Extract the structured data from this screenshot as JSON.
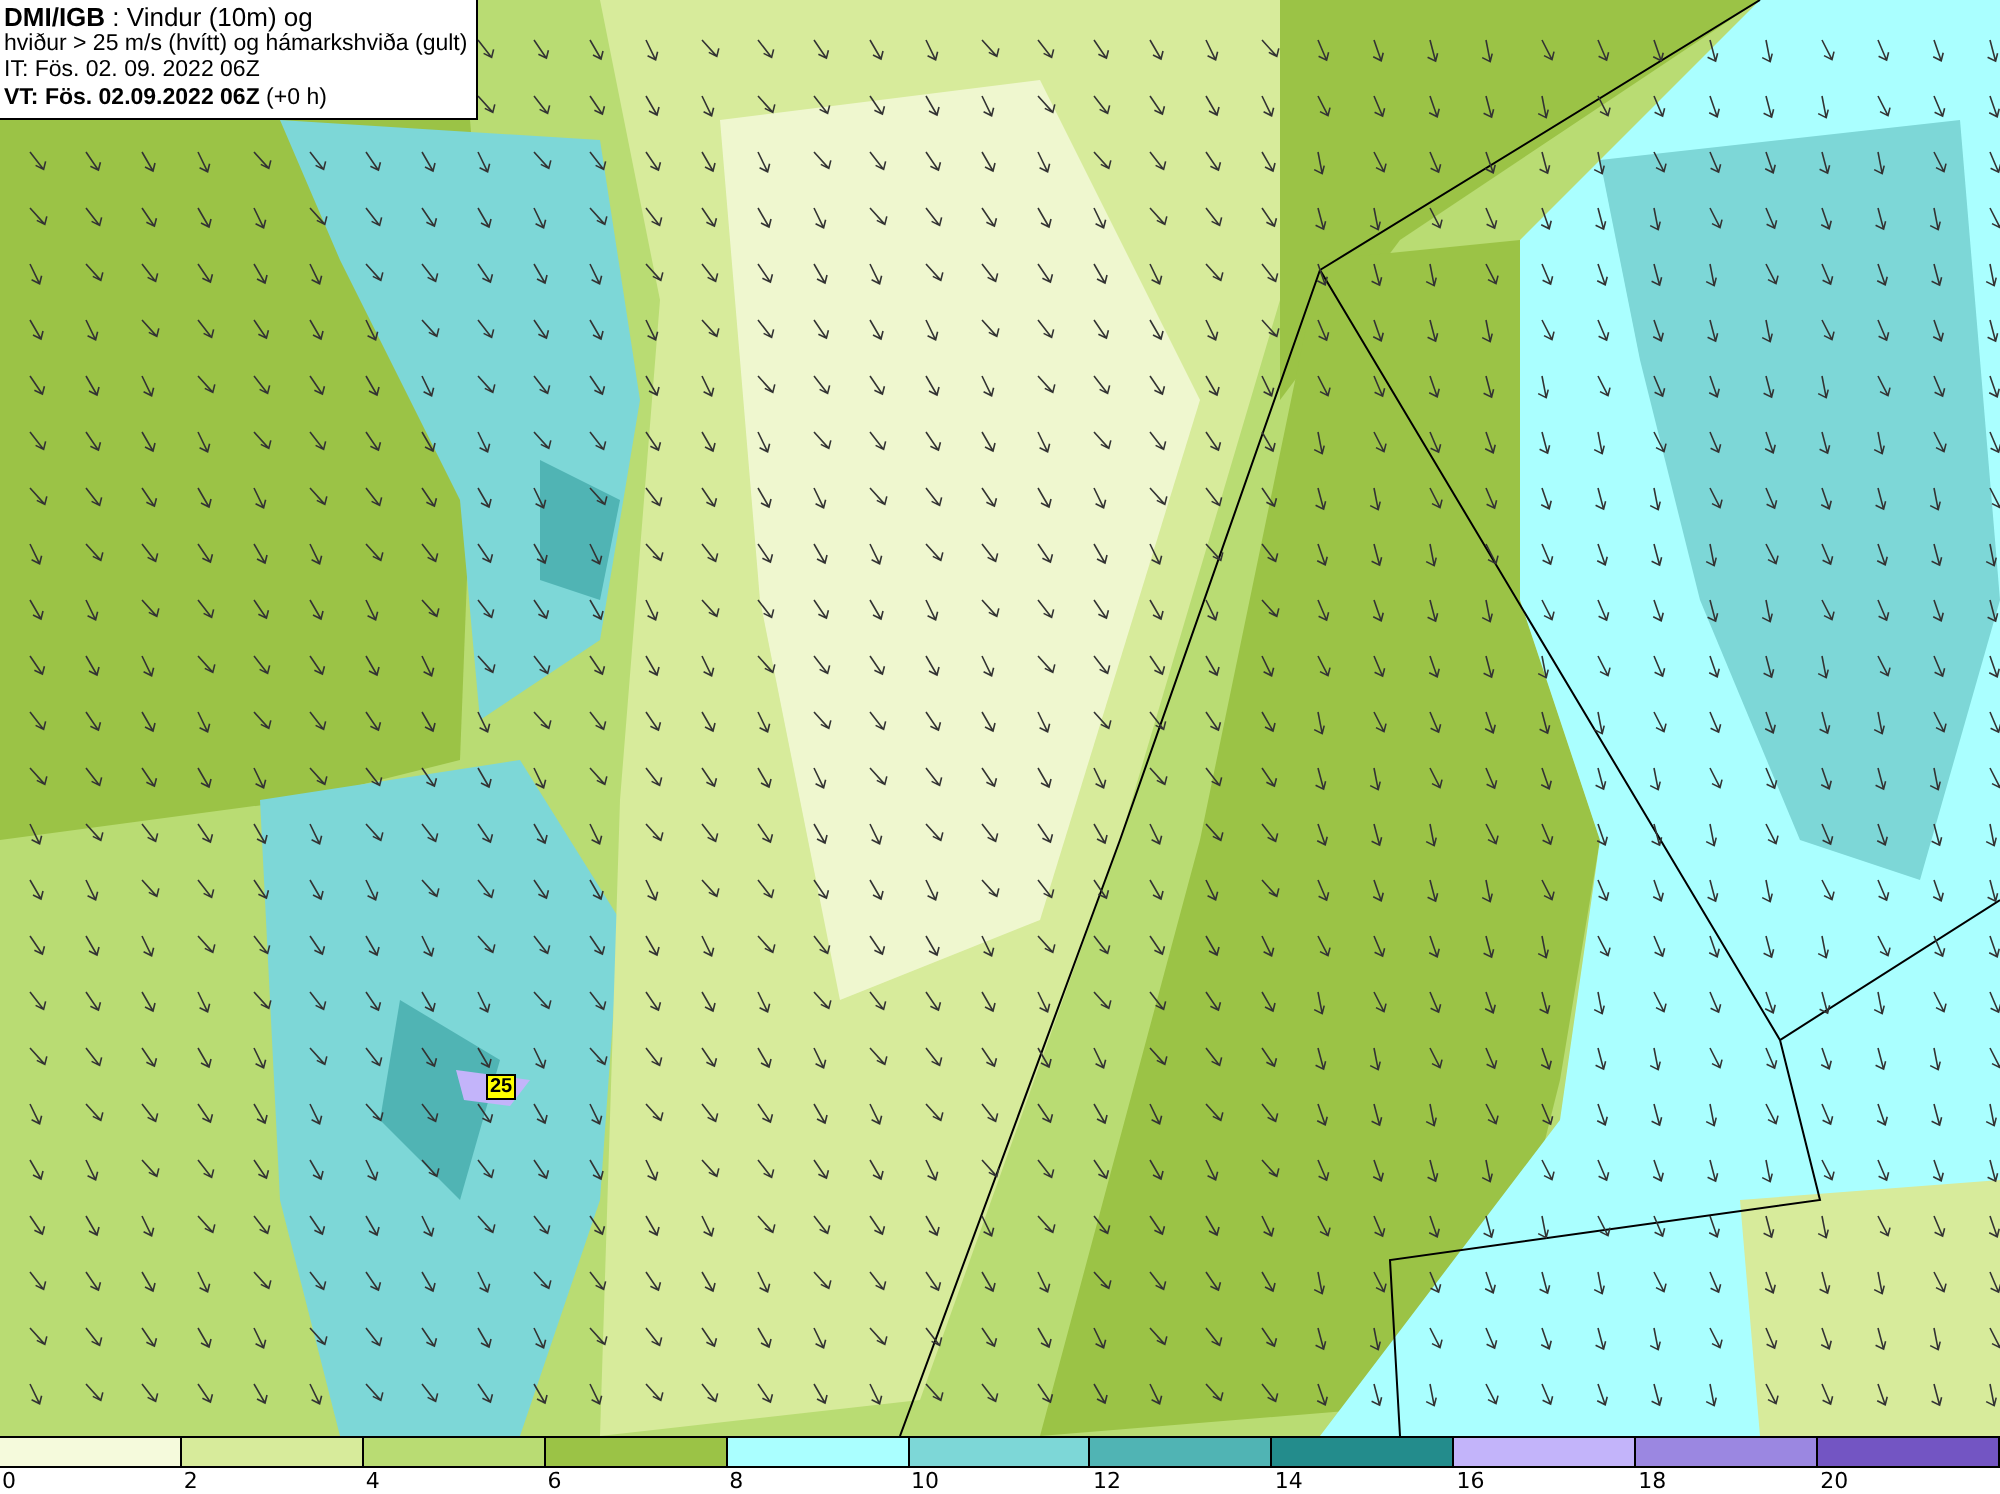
{
  "info_box": {
    "lines": [
      "**DMI/IGB** : Vindur (10m) og",
      "hviður > 25 m/s (hvítt) og hámarkshviða (gult)",
      "IT: Fös. 02. 09. 2022 06Z",
      "**VT: Fös. 02.09.2022 06Z** (+0 h)"
    ]
  },
  "map": {
    "gust_label": "25"
  },
  "legend": {
    "bins": [
      {
        "label": "0",
        "color": "#f5fadc"
      },
      {
        "label": "2",
        "color": "#d7eb9b"
      },
      {
        "label": "4",
        "color": "#b9dc73"
      },
      {
        "label": "6",
        "color": "#9bc346"
      },
      {
        "label": "8",
        "color": "#aaffff"
      },
      {
        "label": "10",
        "color": "#7dd7d7"
      },
      {
        "label": "12",
        "color": "#50b4b4"
      },
      {
        "label": "14",
        "color": "#238c8c"
      },
      {
        "label": "16",
        "color": "#c3b4fa"
      },
      {
        "label": "18",
        "color": "#9b87e1"
      },
      {
        "label": "20",
        "color": "#7355c3"
      }
    ]
  }
}
